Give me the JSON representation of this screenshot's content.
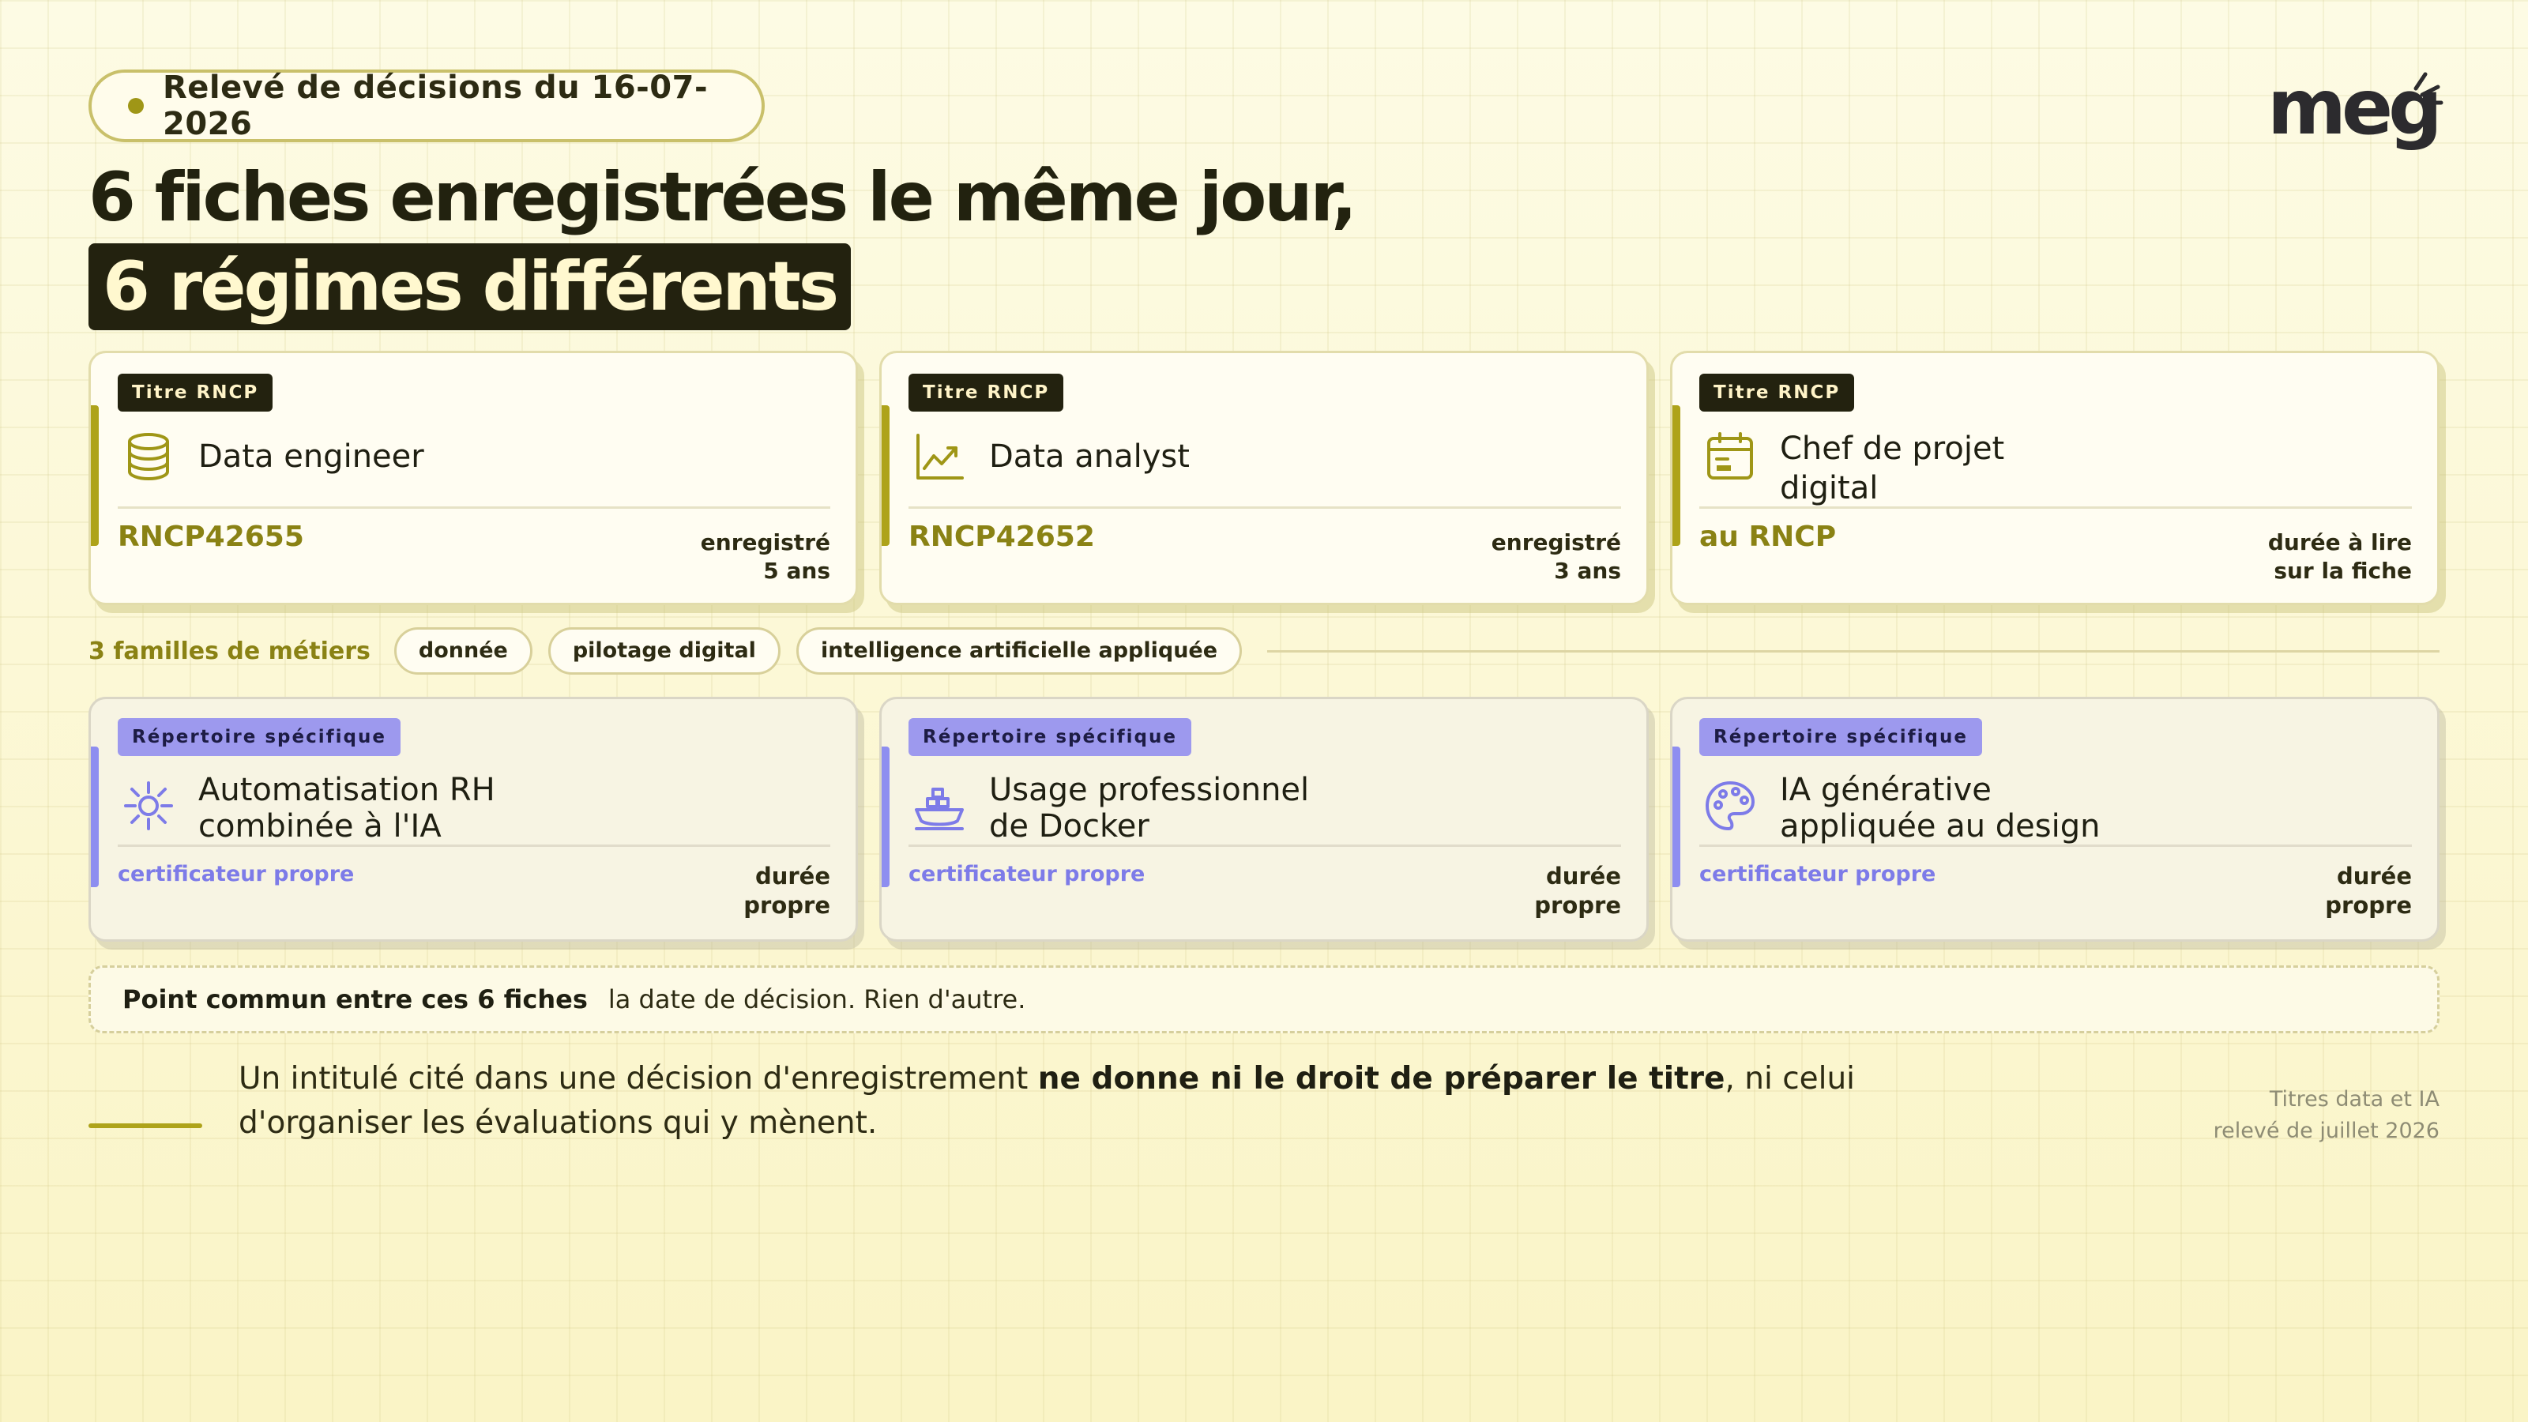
{
  "header": {
    "pill_label": "Relevé de décisions du 16-07-2026",
    "logo_text": "meg"
  },
  "title": {
    "line1": "6 fiches enregistrées le même jour,",
    "line2": "6 régimes différents"
  },
  "cards_rncp": [
    {
      "tag": "Titre RNCP",
      "icon": "database-icon",
      "name": "Data engineer",
      "code": "RNCP42655",
      "meta_1": "enregistré",
      "meta_2": "5 ans"
    },
    {
      "tag": "Titre RNCP",
      "icon": "trending-chart-icon",
      "name": "Data analyst",
      "code": "RNCP42652",
      "meta_1": "enregistré",
      "meta_2": "3 ans"
    },
    {
      "tag": "Titre RNCP",
      "icon": "calendar-icon",
      "name": "Chef de projet",
      "name_2": "digital",
      "code": "au RNCP",
      "meta_1": "durée à lire",
      "meta_2": "sur la fiche"
    }
  ],
  "families": {
    "label": "3 familles de métiers",
    "chips": [
      "donnée",
      "pilotage digital",
      "intelligence artificielle appliquée"
    ]
  },
  "cards_rs": [
    {
      "tag": "Répertoire spécifique",
      "icon": "sun-gear-icon",
      "name": "Automatisation RH",
      "name_2": "combinée à l'IA",
      "code": "certificateur propre",
      "meta_1": "durée",
      "meta_2": "propre"
    },
    {
      "tag": "Répertoire spécifique",
      "icon": "docker-ship-icon",
      "name": "Usage professionnel",
      "name_2": "de Docker",
      "code": "certificateur propre",
      "meta_1": "durée",
      "meta_2": "propre"
    },
    {
      "tag": "Répertoire spécifique",
      "icon": "palette-icon",
      "name": "IA générative",
      "name_2": "appliquée au design",
      "code": "certificateur propre",
      "meta_1": "durée",
      "meta_2": "propre"
    }
  ],
  "common": {
    "label": "Point commun entre ces 6 fiches",
    "text": "la date de décision. Rien d'autre."
  },
  "statement": {
    "part1": "Un intitulé cité dans une décision d'enregistrement ",
    "bold": "ne donne ni le droit de préparer le titre",
    "part2": ", ni celui d'organiser les évaluations qui y mènent."
  },
  "source": {
    "line1": "Titres data et IA",
    "line2": "relevé de juillet 2026"
  },
  "colors": {
    "background": "#fcf8d6",
    "olive_accent": "#aea31a",
    "dark": "#23220f",
    "purple_accent": "#9d99ee"
  }
}
